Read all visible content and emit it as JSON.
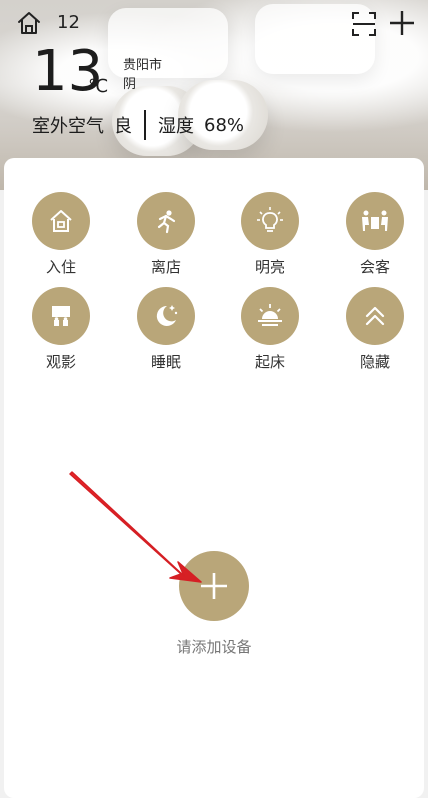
{
  "header": {
    "room_number": "12",
    "temperature": "13",
    "temperature_unit": "℃",
    "city": "贵阳市",
    "weather": "阴",
    "air_label": "室外空气",
    "air_quality": "良",
    "humidity_label": "湿度",
    "humidity_value": "68%"
  },
  "scenes": [
    {
      "label": "入住",
      "icon": "home-icon"
    },
    {
      "label": "离店",
      "icon": "running-person-icon"
    },
    {
      "label": "明亮",
      "icon": "lightbulb-icon"
    },
    {
      "label": "会客",
      "icon": "meeting-icon"
    },
    {
      "label": "观影",
      "icon": "cinema-icon"
    },
    {
      "label": "睡眠",
      "icon": "moon-stars-icon"
    },
    {
      "label": "起床",
      "icon": "sunrise-icon"
    },
    {
      "label": "隐藏",
      "icon": "chevron-up-double-icon"
    }
  ],
  "add_device": {
    "label": "请添加设备"
  },
  "colors": {
    "accent": "#b9a679",
    "arrow": "#e8262a"
  }
}
